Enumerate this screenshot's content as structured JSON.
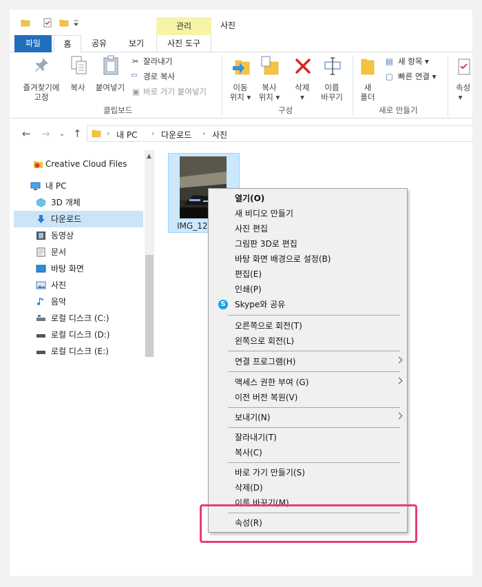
{
  "colors": {
    "accent": "#1f6fbf",
    "selection": "#cce4f7",
    "manage_tab": "#f7f4a8",
    "highlight": "#e83a7a"
  },
  "titlebar": {
    "manage_tab": "관리",
    "title": "사진"
  },
  "tabs": {
    "file": "파일",
    "home": "홈",
    "share": "공유",
    "view": "보기",
    "photo_tools": "사진 도구"
  },
  "ribbon": {
    "pin": [
      "즐겨찾기에",
      "고정"
    ],
    "copy": "복사",
    "paste": "붙여넣기",
    "cut": "잘라내기",
    "copy_path": "경로 복사",
    "paste_shortcut": "바로 가기 붙여넣기",
    "clipboard_group": "클립보드",
    "move_to": [
      "이동",
      "위치"
    ],
    "copy_to": [
      "복사",
      "위치"
    ],
    "delete": "삭제",
    "rename": [
      "이름",
      "바꾸기"
    ],
    "organize_group": "구성",
    "new_folder": [
      "새",
      "폴더"
    ],
    "new_item": "새 항목",
    "easy_access": "빠른 연결",
    "new_group": "새로 만들기",
    "properties": "속성"
  },
  "address": {
    "crumbs": [
      "내 PC",
      "다운로드",
      "사진"
    ]
  },
  "sidebar": {
    "items": [
      {
        "label": "Creative Cloud Files",
        "icon": "creative-cloud-icon"
      },
      {
        "label": "내 PC",
        "icon": "pc-icon"
      },
      {
        "label": "3D 개체",
        "icon": "3d-objects-icon"
      },
      {
        "label": "다운로드",
        "icon": "download-icon"
      },
      {
        "label": "동영상",
        "icon": "video-icon"
      },
      {
        "label": "문서",
        "icon": "document-icon"
      },
      {
        "label": "바탕 화면",
        "icon": "desktop-icon"
      },
      {
        "label": "사진",
        "icon": "pictures-icon"
      },
      {
        "label": "음악",
        "icon": "music-icon"
      },
      {
        "label": "로컬 디스크 (C:)",
        "icon": "drive-icon"
      },
      {
        "label": "로컬 디스크 (D:)",
        "icon": "drive-icon"
      },
      {
        "label": "로컬 디스크 (E:)",
        "icon": "drive-icon"
      }
    ]
  },
  "file": {
    "name": "IMG_127"
  },
  "menu": {
    "open": "열기(O)",
    "new_video": "새 비디오 만들기",
    "photo_edit": "사진 편집",
    "paint3d": "그림판 3D로 편집",
    "set_bg": "바탕 화면 배경으로 설정(B)",
    "edit": "편집(E)",
    "print": "인쇄(P)",
    "skype": "Skype와 공유",
    "rotate_right": "오른쪽으로 회전(T)",
    "rotate_left": "왼쪽으로 회전(L)",
    "open_with": "연결 프로그램(H)",
    "give_access": "액세스 권한 부여 (G)",
    "restore": "이전 버전 복원(V)",
    "send_to": "보내기(N)",
    "cut": "잘라내기(T)",
    "copy": "복사(C)",
    "create_shortcut": "바로 가기 만들기(S)",
    "delete": "삭제(D)",
    "rename": "이름 바꾸기(M)",
    "properties": "속성(R)"
  }
}
